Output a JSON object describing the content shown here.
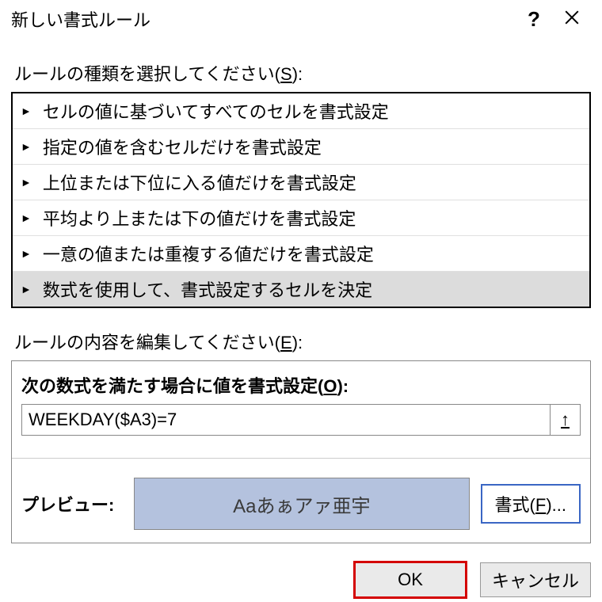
{
  "title": "新しい書式ルール",
  "help_label": "?",
  "select_rule_type_prefix": "ルールの種類を選択してください(",
  "select_rule_type_key": "S",
  "select_rule_type_suffix": "):",
  "rule_types": [
    "セルの値に基づいてすべてのセルを書式設定",
    "指定の値を含むセルだけを書式設定",
    "上位または下位に入る値だけを書式設定",
    "平均より上または下の値だけを書式設定",
    "一意の値または重複する値だけを書式設定",
    "数式を使用して、書式設定するセルを決定"
  ],
  "selected_rule_index": 5,
  "edit_rule_prefix": "ルールの内容を編集してください(",
  "edit_rule_key": "E",
  "edit_rule_suffix": "):",
  "formula_caption_prefix": "次の数式を満たす場合に値を書式設定(",
  "formula_caption_key": "O",
  "formula_caption_suffix": "):",
  "formula_value": "WEEKDAY($A3)=7",
  "preview_label": "プレビュー:",
  "preview_sample": "Aaあぁアァ亜宇",
  "preview_fill": "#b4c2de",
  "format_button_prefix": "書式(",
  "format_button_key": "F",
  "format_button_suffix": ")...",
  "ok_label": "OK",
  "cancel_label": "キャンセル"
}
